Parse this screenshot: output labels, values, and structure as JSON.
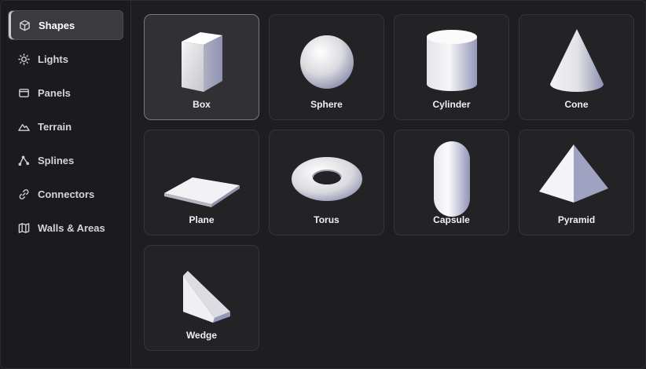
{
  "sidebar": {
    "items": [
      {
        "label": "Shapes",
        "icon": "cube-icon",
        "active": true
      },
      {
        "label": "Lights",
        "icon": "sun-icon",
        "active": false
      },
      {
        "label": "Panels",
        "icon": "panel-icon",
        "active": false
      },
      {
        "label": "Terrain",
        "icon": "mountain-icon",
        "active": false
      },
      {
        "label": "Splines",
        "icon": "spline-icon",
        "active": false
      },
      {
        "label": "Connectors",
        "icon": "link-icon",
        "active": false
      },
      {
        "label": "Walls & Areas",
        "icon": "map-icon",
        "active": false
      }
    ]
  },
  "shapes": [
    {
      "label": "Box",
      "icon": "box-shape-icon",
      "selected": true
    },
    {
      "label": "Sphere",
      "icon": "sphere-shape-icon",
      "selected": false
    },
    {
      "label": "Cylinder",
      "icon": "cylinder-shape-icon",
      "selected": false
    },
    {
      "label": "Cone",
      "icon": "cone-shape-icon",
      "selected": false
    },
    {
      "label": "Plane",
      "icon": "plane-shape-icon",
      "selected": false
    },
    {
      "label": "Torus",
      "icon": "torus-shape-icon",
      "selected": false
    },
    {
      "label": "Capsule",
      "icon": "capsule-shape-icon",
      "selected": false
    },
    {
      "label": "Pyramid",
      "icon": "pyramid-shape-icon",
      "selected": false
    },
    {
      "label": "Wedge",
      "icon": "wedge-shape-icon",
      "selected": false
    }
  ]
}
